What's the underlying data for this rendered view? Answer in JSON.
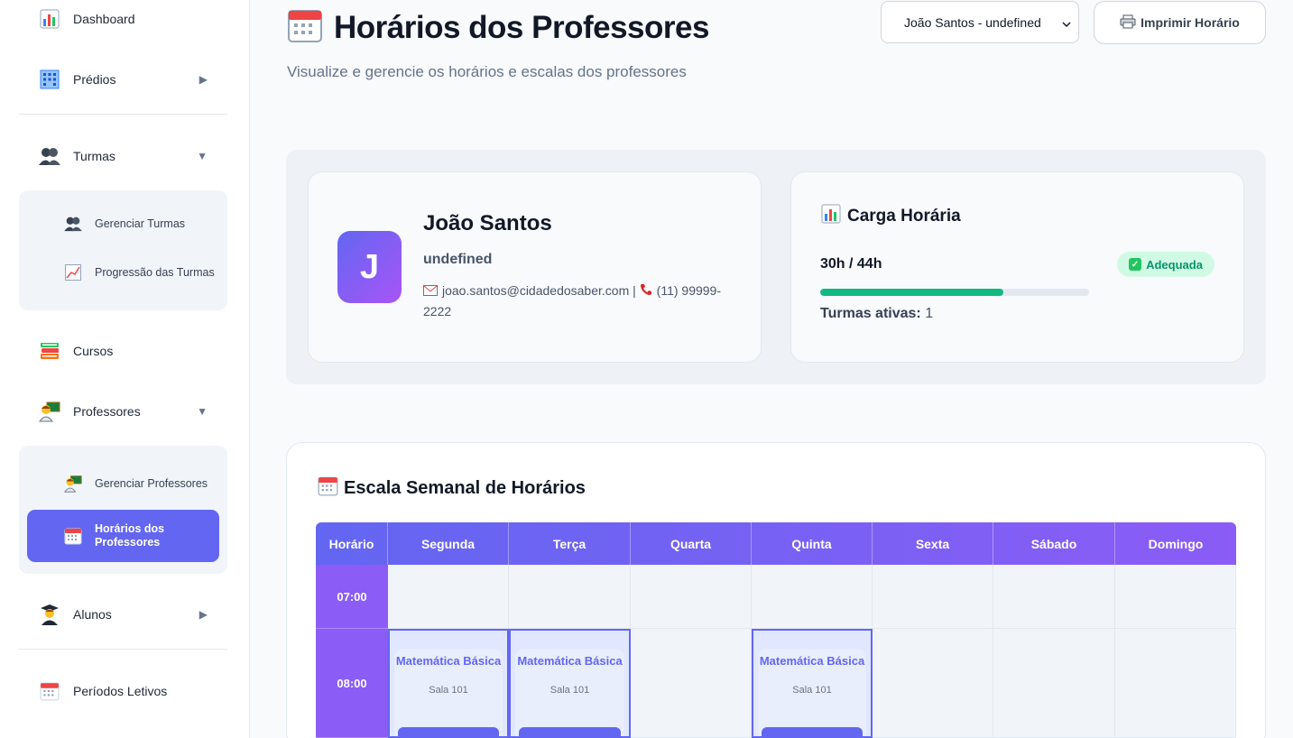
{
  "sidebar": {
    "items": [
      {
        "label": "Dashboard",
        "icon": "bar-chart-icon"
      },
      {
        "label": "Prédios",
        "icon": "building-icon",
        "arrow": "▶"
      },
      {
        "label": "Turmas",
        "icon": "people-icon",
        "arrow": "▼"
      },
      {
        "label": "Cursos",
        "icon": "books-icon"
      },
      {
        "label": "Professores",
        "icon": "teacher-icon",
        "arrow": "▼"
      },
      {
        "label": "Alunos",
        "icon": "student-icon",
        "arrow": "▶"
      },
      {
        "label": "Períodos Letivos",
        "icon": "calendar-icon"
      }
    ],
    "turmas_sub": [
      {
        "label": "Gerenciar Turmas",
        "icon": "people-icon"
      },
      {
        "label": "Progressão das Turmas",
        "icon": "trend-chart-icon"
      }
    ],
    "professores_sub": [
      {
        "label": "Gerenciar Professores",
        "icon": "teacher-icon"
      },
      {
        "label": "Horários dos Professores",
        "icon": "calendar-icon",
        "active": true
      }
    ]
  },
  "header": {
    "title": "Horários dos Professores",
    "subtitle": "Visualize e gerencie os horários e escalas dos professores",
    "select_value": "João Santos - undefined",
    "print_label": "Imprimir Horário"
  },
  "professor": {
    "initial": "J",
    "name": "João Santos",
    "subtitle": "undefined",
    "email": "joao.santos@cidadedosaber.com",
    "separator": "|",
    "phone": "(11) 99999-2222"
  },
  "load": {
    "title": "Carga Horária",
    "hours": "30h / 44h",
    "progress_fraction": 0.6818,
    "status": "Adequada",
    "active_label": "Turmas ativas:",
    "active_value": "1"
  },
  "schedule": {
    "title": "Escala Semanal de Horários",
    "columns": [
      "Horário",
      "Segunda",
      "Terça",
      "Quarta",
      "Quinta",
      "Sexta",
      "Sábado",
      "Domingo"
    ],
    "rows": [
      {
        "time": "07:00",
        "lessons": [
          null,
          null,
          null,
          null,
          null,
          null,
          null
        ]
      },
      {
        "time": "08:00",
        "lessons": [
          {
            "name": "Matemática Básica",
            "room": "Sala 101"
          },
          {
            "name": "Matemática Básica",
            "room": "Sala 101"
          },
          null,
          {
            "name": "Matemática Básica",
            "room": "Sala 101"
          },
          null,
          null,
          null
        ]
      }
    ]
  },
  "colors": {
    "accent": "#6366f1",
    "accent2": "#8b5cf6",
    "success": "#10b981"
  }
}
